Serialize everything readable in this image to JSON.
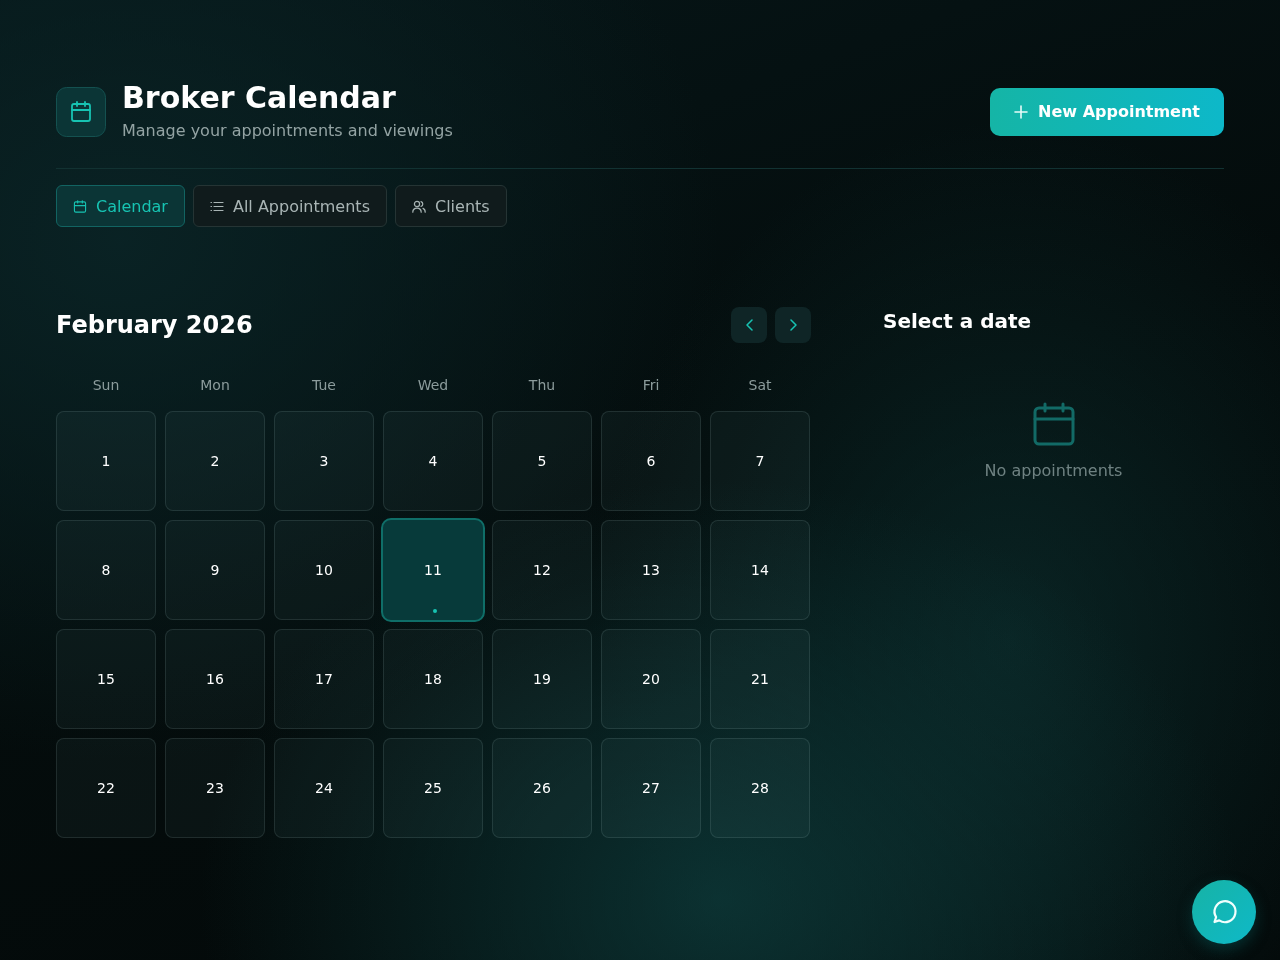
{
  "header": {
    "title": "Broker Calendar",
    "subtitle": "Manage your appointments and viewings",
    "action": "New Appointment"
  },
  "tabs": [
    {
      "label": "Calendar",
      "kind": "calendar",
      "selected": true
    },
    {
      "label": "All Appointments",
      "kind": "list",
      "selected": false
    },
    {
      "label": "Clients",
      "kind": "users",
      "selected": false
    }
  ],
  "calendar": {
    "month": "February 2026",
    "weekdays": [
      "Sun",
      "Mon",
      "Tue",
      "Wed",
      "Thu",
      "Fri",
      "Sat"
    ],
    "days": [
      {
        "label": "1",
        "today": false
      },
      {
        "label": "2",
        "today": false
      },
      {
        "label": "3",
        "today": false
      },
      {
        "label": "4",
        "today": false
      },
      {
        "label": "5",
        "today": false
      },
      {
        "label": "6",
        "today": false
      },
      {
        "label": "7",
        "today": false
      },
      {
        "label": "8",
        "today": false
      },
      {
        "label": "9",
        "today": false
      },
      {
        "label": "10",
        "today": false
      },
      {
        "label": "11",
        "today": true
      },
      {
        "label": "12",
        "today": false
      },
      {
        "label": "13",
        "today": false
      },
      {
        "label": "14",
        "today": false
      },
      {
        "label": "15",
        "today": false
      },
      {
        "label": "16",
        "today": false
      },
      {
        "label": "17",
        "today": false
      },
      {
        "label": "18",
        "today": false
      },
      {
        "label": "19",
        "today": false
      },
      {
        "label": "20",
        "today": false
      },
      {
        "label": "21",
        "today": false
      },
      {
        "label": "22",
        "today": false
      },
      {
        "label": "23",
        "today": false
      },
      {
        "label": "24",
        "today": false
      },
      {
        "label": "25",
        "today": false
      },
      {
        "label": "26",
        "today": false
      },
      {
        "label": "27",
        "today": false
      },
      {
        "label": "28",
        "today": false
      }
    ]
  },
  "day_panel": {
    "title": "Select a date",
    "empty_text": "No appointments"
  }
}
